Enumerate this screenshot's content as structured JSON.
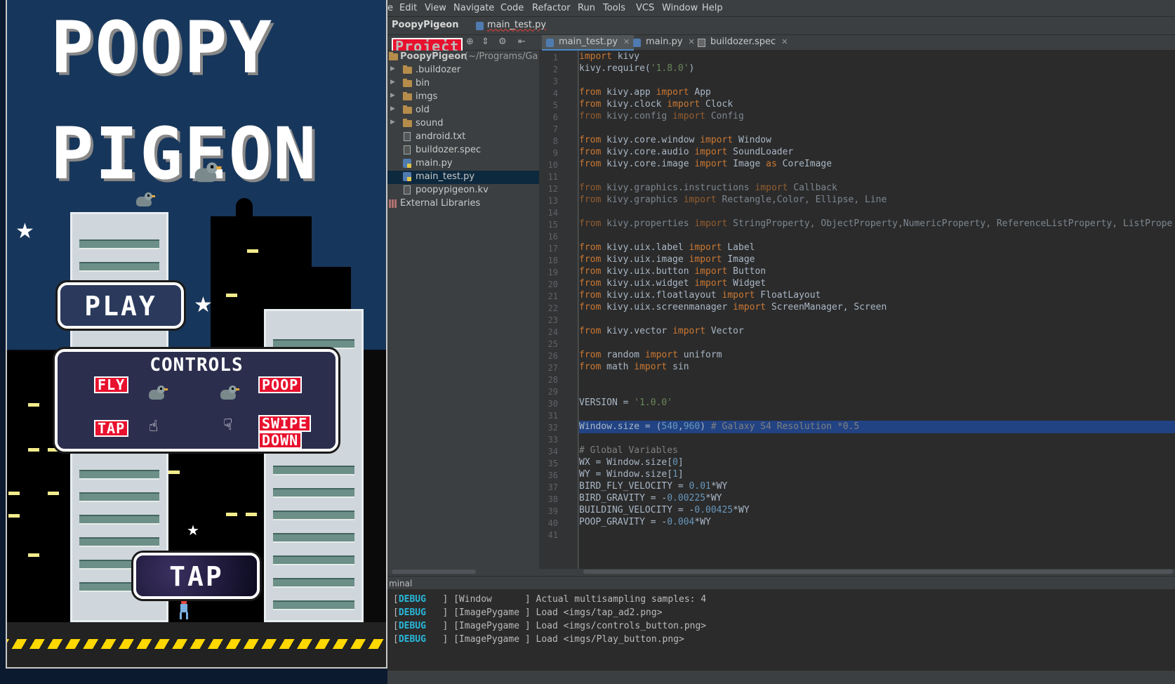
{
  "menu": [
    "e",
    "Edit",
    "View",
    "Navigate",
    "Code",
    "Refactor",
    "Run",
    "Tools",
    "VCS",
    "Window",
    "Help"
  ],
  "nav": {
    "project": "PoopyPigeon",
    "file": "main_test.py"
  },
  "project_panel": {
    "label": "Project"
  },
  "tree": [
    {
      "label": "PoopyPigeon",
      "extra": " (~/Programs/Ga",
      "kind": "root"
    },
    {
      "label": ".buildozer",
      "kind": "folder"
    },
    {
      "label": "bin",
      "kind": "folder"
    },
    {
      "label": "imgs",
      "kind": "folder"
    },
    {
      "label": "old",
      "kind": "folder"
    },
    {
      "label": "sound",
      "kind": "folder"
    },
    {
      "label": "android.txt",
      "kind": "doc"
    },
    {
      "label": "buildozer.spec",
      "kind": "doc"
    },
    {
      "label": "main.py",
      "kind": "py"
    },
    {
      "label": "main_test.py",
      "kind": "py",
      "selected": true
    },
    {
      "label": "poopypigeon.kv",
      "kind": "doc"
    },
    {
      "label": "External Libraries",
      "kind": "lib"
    }
  ],
  "tabs": [
    {
      "label": "main_test.py",
      "active": true,
      "icon": "python-file-icon"
    },
    {
      "label": "main.py",
      "active": false,
      "icon": "python-file-icon"
    },
    {
      "label": "buildozer.spec",
      "active": false,
      "icon": "spec-file-icon"
    }
  ],
  "code_lines": [
    "import kivy",
    "kivy.require('1.8.0')",
    "",
    "from kivy.app import App",
    "from kivy.clock import Clock",
    "from kivy.config import Config",
    "",
    "from kivy.core.window import Window",
    "from kivy.core.audio import SoundLoader",
    "from kivy.core.image import Image as CoreImage",
    "",
    "from kivy.graphics.instructions import Callback",
    "from kivy.graphics import Rectangle,Color, Ellipse, Line",
    "",
    "from kivy.properties import StringProperty, ObjectProperty,NumericProperty, ReferenceListProperty, ListPrope",
    "",
    "from kivy.uix.label import Label",
    "from kivy.uix.image import Image",
    "from kivy.uix.button import Button",
    "from kivy.uix.widget import Widget",
    "from kivy.uix.floatlayout import FloatLayout",
    "from kivy.uix.screenmanager import ScreenManager, Screen",
    "",
    "from kivy.vector import Vector",
    "",
    "from random import uniform",
    "from math import sin",
    "",
    "",
    "VERSION = '1.0.0'",
    "",
    "Window.size = (540,960) # Galaxy S4 Resolution *0.5",
    "",
    "# Global Variables",
    "WX = Window.size[0]",
    "WY = Window.size[1]",
    "BIRD_FLY_VELOCITY = 0.01*WY",
    "BIRD_GRAVITY = -0.00225*WY",
    "BUILDING_VELOCITY = -0.00425*WY",
    "POOP_GRAVITY = -0.004*WY",
    ""
  ],
  "line_numbers": [
    "1",
    "2",
    "3",
    "4",
    "5",
    "6",
    "7",
    "8",
    "9",
    "10",
    "11",
    "12",
    "13",
    "14",
    "15",
    "16",
    "17",
    "18",
    "19",
    "20",
    "21",
    "22",
    "23",
    "24",
    "25",
    "26",
    "27",
    "28",
    "29",
    "30",
    "31",
    "32",
    "33",
    "34",
    "35",
    "36",
    "37",
    "38",
    "39",
    "40",
    "41"
  ],
  "highlighted_line": 32,
  "terminal": {
    "title": "minal",
    "lines": [
      {
        "tag": "DEBUG",
        "text": "   ] [Window      ] Actual multisampling samples: 4"
      },
      {
        "tag": "DEBUG",
        "text": "   ] [ImagePygame ] Load <imgs/tap_ad2.png>"
      },
      {
        "tag": "DEBUG",
        "text": "   ] [ImagePygame ] Load <imgs/controls_button.png>"
      },
      {
        "tag": "DEBUG",
        "text": "   ] [ImagePygame ] Load <imgs/Play_button.png>"
      }
    ]
  },
  "game": {
    "title_line1": "POOPY",
    "title_line2": "PIGEON",
    "play_label": "PLAY",
    "controls_title": "CONTROLS",
    "fly_label": "FLY",
    "poop_label": "POOP",
    "tap_label": "TAP",
    "swipe_label": "SWIPE",
    "down_label": "DOWN",
    "tap_button_label": "TAP"
  },
  "colors": {
    "keyword": "#cc7832",
    "string": "#6a8759",
    "number": "#6897bb",
    "comment": "#808080",
    "selection": "#214283",
    "accent_red": "#e8112e",
    "hazard_yellow": "#ffd800"
  }
}
